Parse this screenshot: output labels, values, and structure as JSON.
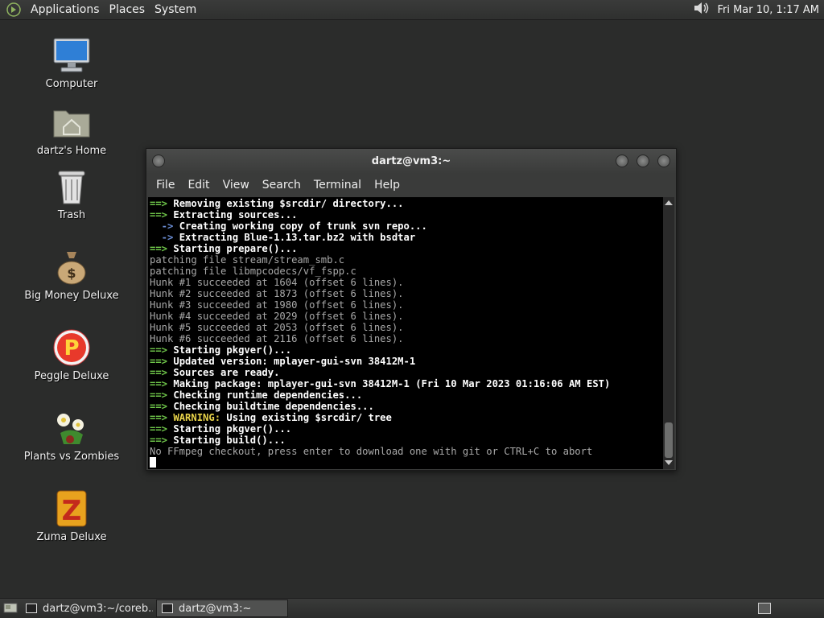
{
  "top_panel": {
    "menus": [
      "Applications",
      "Places",
      "System"
    ],
    "clock": "Fri Mar 10,  1:17 AM",
    "icons": {
      "menu": "gnome-foot-icon",
      "volume": "speaker-icon"
    }
  },
  "desktop": {
    "icons": [
      {
        "label": "Computer",
        "icon": "computer-icon"
      },
      {
        "label": "dartz's Home",
        "icon": "home-folder-icon"
      },
      {
        "label": "Trash",
        "icon": "trash-icon"
      },
      {
        "label": "Big Money Deluxe",
        "icon": "money-bag-icon"
      },
      {
        "label": "Peggle Deluxe",
        "icon": "peggle-icon"
      },
      {
        "label": "Plants vs Zombies",
        "icon": "plants-icon"
      },
      {
        "label": "Zuma Deluxe",
        "icon": "zuma-icon"
      }
    ]
  },
  "window": {
    "title": "dartz@vm3:~",
    "menu": [
      "File",
      "Edit",
      "View",
      "Search",
      "Terminal",
      "Help"
    ],
    "lines": [
      {
        "kind": "arrow",
        "text": "Removing existing $srcdir/ directory..."
      },
      {
        "kind": "arrow",
        "text": "Extracting sources..."
      },
      {
        "kind": "sub",
        "text": "Creating working copy of trunk svn repo..."
      },
      {
        "kind": "sub",
        "text": "Extracting Blue-1.13.tar.bz2 with bsdtar"
      },
      {
        "kind": "arrow",
        "text": "Starting prepare()..."
      },
      {
        "kind": "plain",
        "text": "patching file stream/stream_smb.c"
      },
      {
        "kind": "plain",
        "text": "patching file libmpcodecs/vf_fspp.c"
      },
      {
        "kind": "plain",
        "text": "Hunk #1 succeeded at 1604 (offset 6 lines)."
      },
      {
        "kind": "plain",
        "text": "Hunk #2 succeeded at 1873 (offset 6 lines)."
      },
      {
        "kind": "plain",
        "text": "Hunk #3 succeeded at 1980 (offset 6 lines)."
      },
      {
        "kind": "plain",
        "text": "Hunk #4 succeeded at 2029 (offset 6 lines)."
      },
      {
        "kind": "plain",
        "text": "Hunk #5 succeeded at 2053 (offset 6 lines)."
      },
      {
        "kind": "plain",
        "text": "Hunk #6 succeeded at 2116 (offset 6 lines)."
      },
      {
        "kind": "arrow",
        "text": "Starting pkgver()..."
      },
      {
        "kind": "arrow",
        "text": "Updated version: mplayer-gui-svn 38412M-1"
      },
      {
        "kind": "arrow",
        "text": "Sources are ready."
      },
      {
        "kind": "arrow",
        "text": "Making package: mplayer-gui-svn 38412M-1 (Fri 10 Mar 2023 01:16:06 AM EST)"
      },
      {
        "kind": "arrow",
        "text": "Checking runtime dependencies..."
      },
      {
        "kind": "arrow",
        "text": "Checking buildtime dependencies..."
      },
      {
        "kind": "warn",
        "prefix": "WARNING:",
        "text": " Using existing $srcdir/ tree"
      },
      {
        "kind": "arrow",
        "text": "Starting pkgver()..."
      },
      {
        "kind": "arrow",
        "text": "Starting build()..."
      },
      {
        "kind": "plain",
        "text": "No FFmpeg checkout, press enter to download one with git or CTRL+C to abort"
      }
    ],
    "arrow_prefix": "==>",
    "sub_prefix": "  ->"
  },
  "taskbar": {
    "tasks": [
      {
        "label": "dartz@vm3:~/coreb...",
        "active": false
      },
      {
        "label": "dartz@vm3:~",
        "active": true
      }
    ]
  }
}
